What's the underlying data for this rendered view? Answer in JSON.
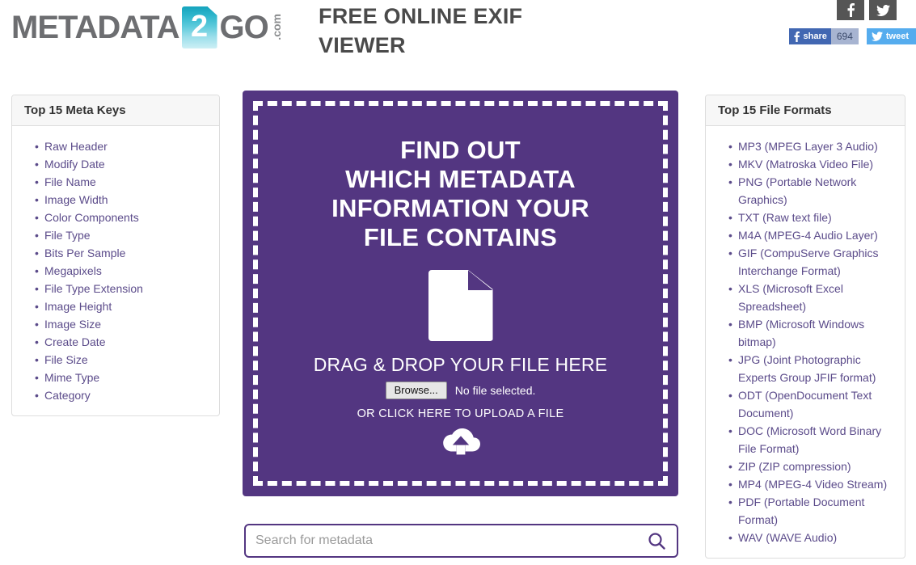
{
  "header": {
    "logo": {
      "part1": "METADATA",
      "badge": "2",
      "part2": "GO",
      "suffix": ".com"
    },
    "title": "FREE ONLINE EXIF VIEWER",
    "social": {
      "facebook_icon": "facebook-icon",
      "twitter_icon": "twitter-icon",
      "fb_share_label": "share",
      "fb_share_count": "694",
      "tweet_label": "tweet"
    }
  },
  "left_panel": {
    "title": "Top 15 Meta Keys",
    "items": [
      "Raw Header",
      "Modify Date",
      "File Name",
      "Image Width",
      "Color Components",
      "File Type",
      "Bits Per Sample",
      "Megapixels",
      "File Type Extension",
      "Image Height",
      "Image Size",
      "Create Date",
      "File Size",
      "Mime Type",
      "Category"
    ]
  },
  "right_panel": {
    "title": "Top 15 File Formats",
    "items": [
      "MP3 (MPEG Layer 3 Audio)",
      "MKV (Matroska Video File)",
      "PNG (Portable Network Graphics)",
      "TXT (Raw text file)",
      "M4A (MPEG-4 Audio Layer)",
      "GIF (CompuServe Graphics Interchange Format)",
      "XLS (Microsoft Excel Spreadsheet)",
      "BMP (Microsoft Windows bitmap)",
      "JPG (Joint Photographic Experts Group JFIF format)",
      "ODT (OpenDocument Text Document)",
      "DOC (Microsoft Word Binary File Format)",
      "ZIP (ZIP compression)",
      "MP4 (MPEG-4 Video Stream)",
      "PDF (Portable Document Format)",
      "WAV (WAVE Audio)"
    ]
  },
  "dropzone": {
    "headline_line1": "FIND OUT",
    "headline_line2": "WHICH METADATA",
    "headline_line3": "INFORMATION YOUR",
    "headline_line4": "FILE CONTAINS",
    "drag_label": "DRAG & DROP YOUR FILE HERE",
    "browse_label": "Browse...",
    "no_file_label": "No file selected.",
    "or_click_label": "OR CLICK HERE TO UPLOAD A FILE",
    "document_icon": "document-icon",
    "upload_icon": "cloud-upload-icon",
    "background_color": "#533681"
  },
  "search": {
    "placeholder": "Search for metadata",
    "value": "",
    "icon": "search-icon",
    "accent_color": "#533681"
  }
}
